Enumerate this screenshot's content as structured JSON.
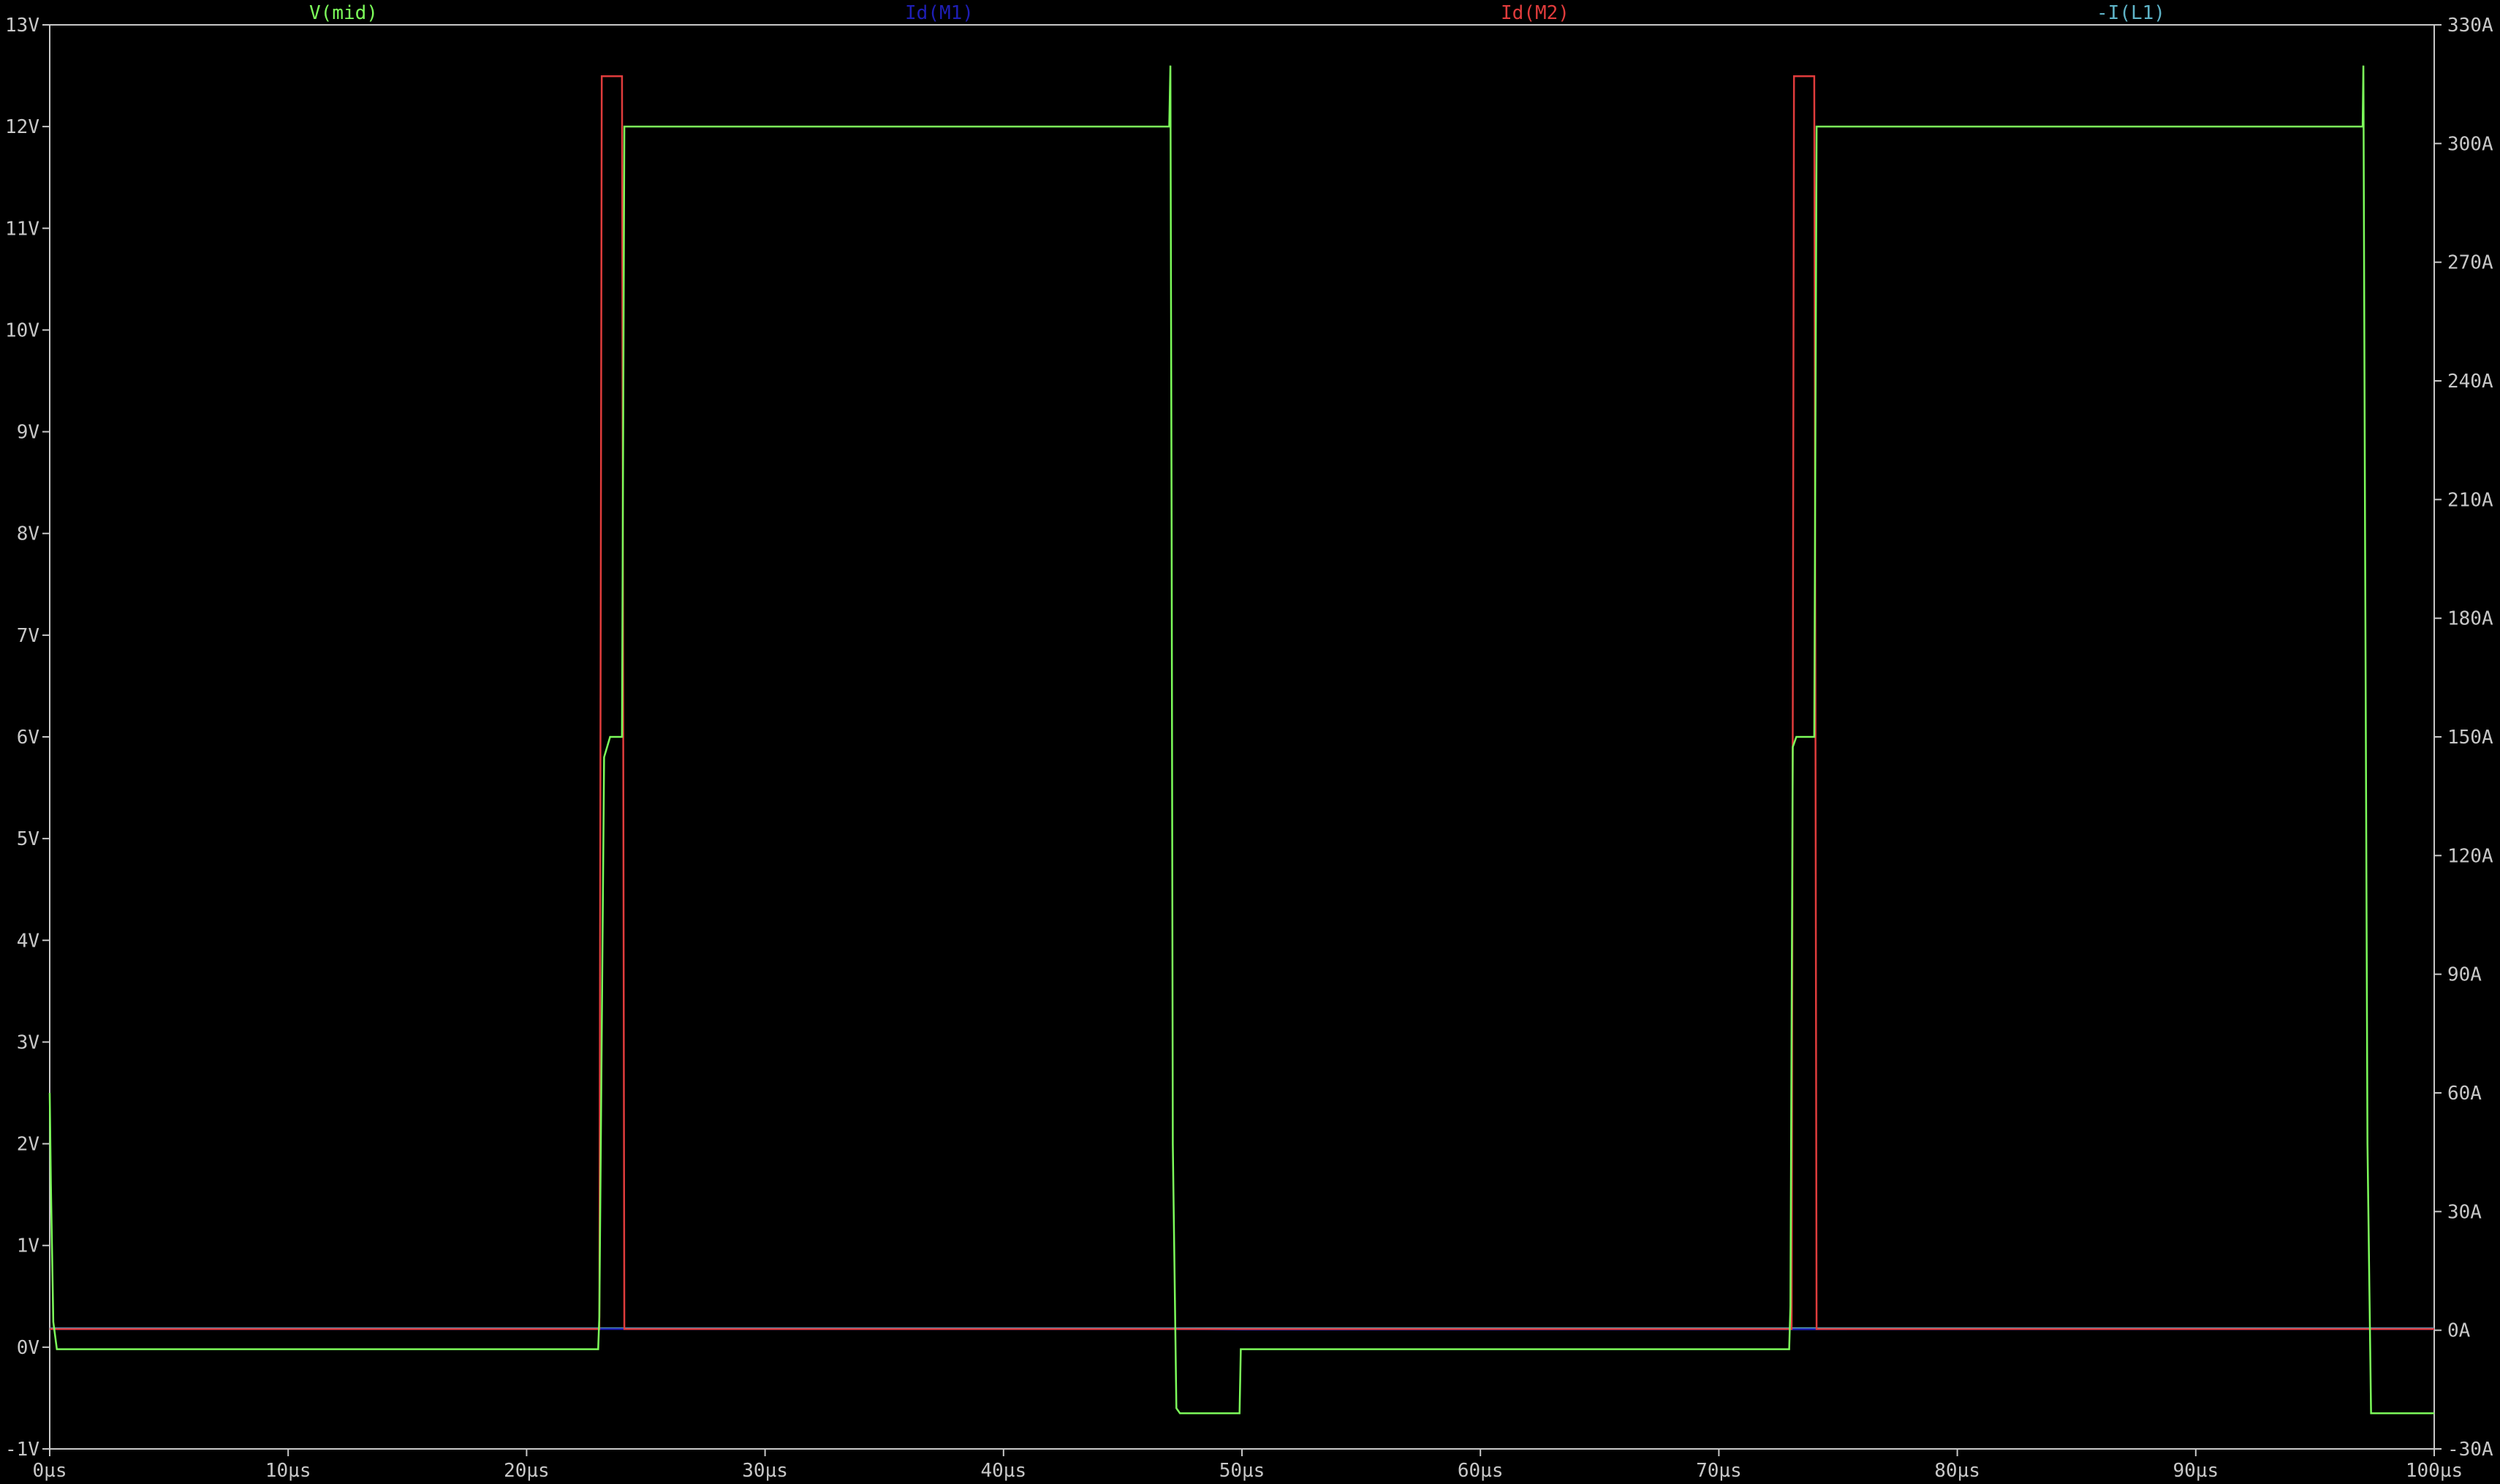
{
  "chart_data": {
    "type": "line",
    "title": "",
    "xlabel": "",
    "ylabel": "",
    "xlim": [
      0,
      100
    ],
    "x_unit": "µs",
    "ylim_left": [
      -1,
      13
    ],
    "ylim_right": [
      -30,
      330
    ],
    "x_ticks": [
      "0µs",
      "10µs",
      "20µs",
      "30µs",
      "40µs",
      "50µs",
      "60µs",
      "70µs",
      "80µs",
      "90µs",
      "100µs"
    ],
    "y_left_ticks": [
      "-1V",
      "0V",
      "1V",
      "2V",
      "3V",
      "4V",
      "5V",
      "6V",
      "7V",
      "8V",
      "9V",
      "10V",
      "11V",
      "12V",
      "13V"
    ],
    "y_right_ticks": [
      "-30A",
      "0A",
      "30A",
      "60A",
      "90A",
      "120A",
      "150A",
      "180A",
      "210A",
      "240A",
      "270A",
      "300A",
      "330A"
    ],
    "grid": false,
    "background": "#000000",
    "frame_color": "#c8c8c8",
    "series": [
      {
        "name": "V(mid)",
        "axis": "left",
        "color": "#7cfc5a",
        "x": [
          0,
          0.05,
          0.15,
          0.3,
          23.0,
          23.05,
          23.25,
          23.5,
          23.6,
          24.0,
          24.05,
          24.1,
          24.15,
          46.95,
          47.0,
          47.05,
          47.1,
          47.25,
          47.4,
          49.9,
          49.95,
          50.05,
          72.95,
          73.0,
          73.1,
          73.25,
          73.35,
          74.0,
          74.05,
          74.1,
          74.15,
          97.0,
          97.03,
          97.1,
          97.2,
          97.35,
          100
        ],
        "y": [
          2.5,
          1.6,
          0.25,
          -0.02,
          -0.02,
          0.3,
          5.8,
          6.0,
          6.0,
          6.0,
          9.0,
          12.0,
          12.0,
          12.0,
          12.6,
          8.0,
          2.0,
          -0.6,
          -0.65,
          -0.65,
          -0.02,
          -0.02,
          -0.02,
          0.4,
          5.9,
          6.0,
          6.0,
          6.0,
          9.0,
          12.0,
          12.0,
          12.0,
          12.6,
          8.0,
          2.0,
          -0.65,
          -0.65
        ]
      },
      {
        "name": "Id(M1)",
        "axis": "right",
        "color": "#1e1eb4",
        "x": [
          0,
          46.9,
          47.0,
          50.0,
          97.0,
          100
        ],
        "y": [
          0.3,
          0.3,
          0.3,
          0.2,
          0.3,
          0.3
        ]
      },
      {
        "name": "Id(M2)",
        "axis": "right",
        "color": "#e03c3c",
        "x": [
          0,
          23.05,
          23.15,
          24.0,
          24.1,
          47.0,
          50.0,
          73.05,
          73.15,
          74.0,
          74.1,
          97.0,
          100
        ],
        "y": [
          0.3,
          0.3,
          317,
          317,
          0.3,
          0.3,
          0.3,
          0.3,
          317,
          317,
          0.3,
          0.3,
          0.3
        ]
      },
      {
        "name": "-I(L1)",
        "axis": "right",
        "color": "#5fb4c8",
        "x": [
          0,
          100
        ],
        "y": [
          0.5,
          0.5
        ]
      }
    ]
  }
}
